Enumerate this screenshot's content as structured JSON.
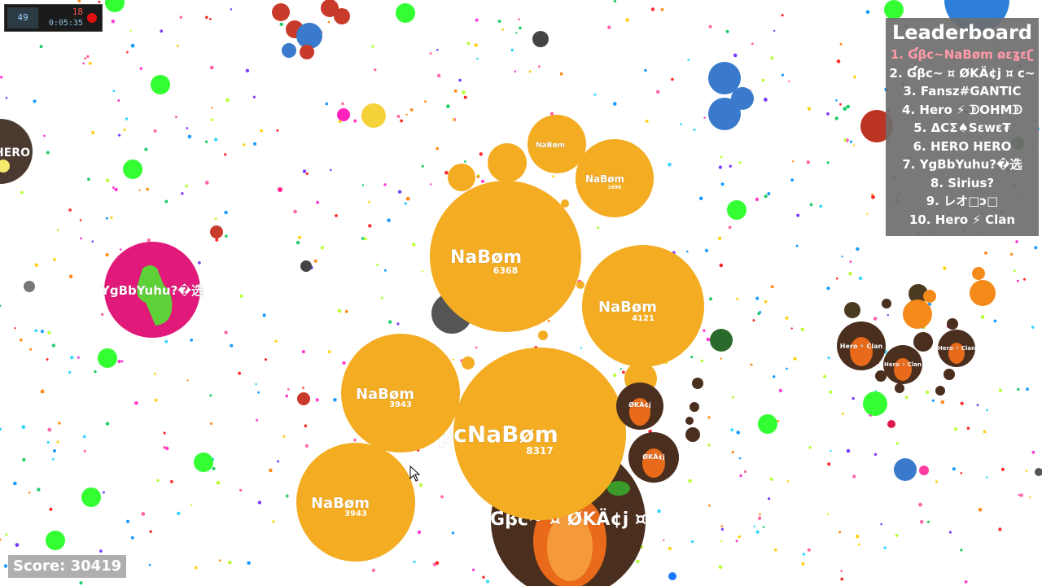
{
  "leaderboard": {
    "title": "Leaderboard",
    "entries": [
      {
        "rank": "1.",
        "name": "Ɠβϲ~NaBøm ɷɛʓɛʗ",
        "self": true
      },
      {
        "rank": "2.",
        "name": "Ɠβϲ~ ¤ ØKÄ¢j ¤ ϲ~",
        "self": false
      },
      {
        "rank": "3.",
        "name": "Fansz#GANTIC",
        "self": false
      },
      {
        "rank": "4.",
        "name": "Hero ⚡ ᗫOHMᗫ",
        "self": false
      },
      {
        "rank": "5.",
        "name": "ΔCΣ♠Sɛwɛ₮",
        "self": false
      },
      {
        "rank": "6.",
        "name": "HERO HERO",
        "self": false
      },
      {
        "rank": "7.",
        "name": "YgBbYuhu?�选",
        "self": false
      },
      {
        "rank": "8.",
        "name": "Sirius?",
        "self": false
      },
      {
        "rank": "9.",
        "name": "レオ□ↄ□",
        "self": false
      },
      {
        "rank": "10.",
        "name": "Hero ⚡ Clan",
        "self": false
      }
    ]
  },
  "score": {
    "label": "Score:",
    "value": "30419"
  },
  "recorder": {
    "fps": "49",
    "count": "18",
    "time": "0:05:35"
  },
  "player": {
    "name": "ƓβϲNaBøm",
    "prefix": "Ɠβϲ~",
    "color": "#f4ac22"
  },
  "cells": [
    {
      "kind": "player",
      "name": "ƓβϲNaBøm",
      "mass": "8317",
      "color": "#f4ac22"
    },
    {
      "kind": "player",
      "name": "NaBøm",
      "mass": "6368",
      "color": "#f4ac22"
    },
    {
      "kind": "player",
      "name": "NaBøm",
      "mass": "4121",
      "color": "#f4ac22"
    },
    {
      "kind": "player",
      "name": "NaBøm",
      "mass": "3943",
      "color": "#f4ac22"
    },
    {
      "kind": "player",
      "name": "NaBøm",
      "mass": "3943",
      "color": "#f4ac22"
    },
    {
      "kind": "player",
      "name": "NaBøm",
      "mass": "1696",
      "color": "#f4ac22"
    },
    {
      "kind": "player",
      "name": "NaBøm",
      "mass": "",
      "color": "#f4ac22"
    },
    {
      "kind": "enemy",
      "name": "Ɠβϲ~ ¤ ØKÄ¢j ¤",
      "color": "#5a3a22"
    },
    {
      "kind": "enemy",
      "name": "YgBbYuhu?�选",
      "color": "#e0197a"
    },
    {
      "kind": "enemy",
      "name": "HERO",
      "color": "#4a3a30"
    },
    {
      "kind": "enemy",
      "name": "Hero ⚡ Clan",
      "color": "#4a2e1e"
    },
    {
      "kind": "enemy",
      "name": "Hero ⚡ Clan",
      "color": "#4a2e1e"
    },
    {
      "kind": "enemy",
      "name": "Hero ⚡ Clan",
      "color": "#4a2e1e"
    },
    {
      "kind": "enemy",
      "name": "ØKÄ¢j",
      "color": "#4a2e1e"
    },
    {
      "kind": "enemy",
      "name": "ØKÄ¢j",
      "color": "#4a2e1e"
    }
  ],
  "colors": {
    "food_green": "#33ee33",
    "virus_green": "#33ff33",
    "leaderboard_bg": "#6e6e6e",
    "self_highlight": "#ff9aa8",
    "background": "#ffffff"
  }
}
